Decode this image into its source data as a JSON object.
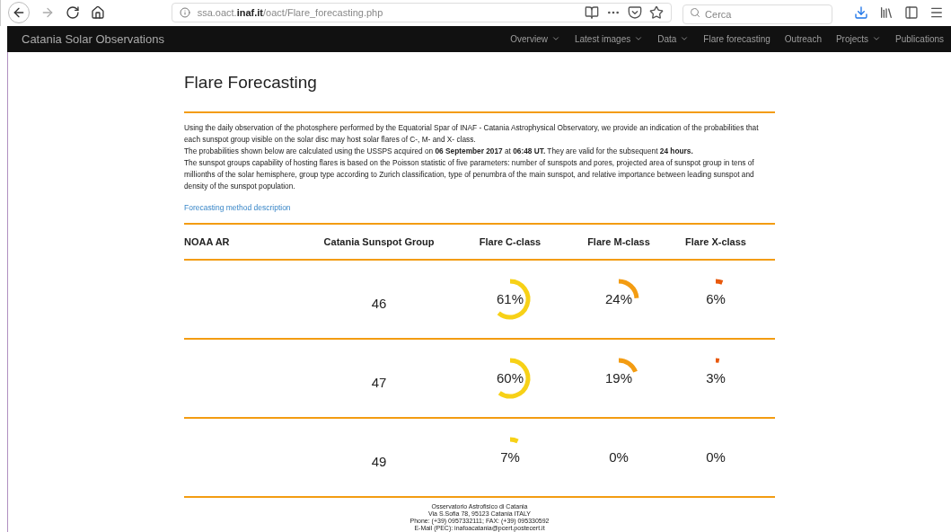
{
  "browser": {
    "url_host": "ssa.oact.",
    "url_domain": "inaf.it",
    "url_path": "/oact/Flare_forecasting.php",
    "search": {
      "placeholder": "Cerca"
    }
  },
  "navbar": {
    "brand": "Catania Solar Observations",
    "items": [
      {
        "label": "Overview",
        "dropdown": true
      },
      {
        "label": "Latest images",
        "dropdown": true
      },
      {
        "label": "Data",
        "dropdown": true
      },
      {
        "label": "Flare forecasting",
        "dropdown": false
      },
      {
        "label": "Outreach",
        "dropdown": false
      },
      {
        "label": "Projects",
        "dropdown": true
      },
      {
        "label": "Publications",
        "dropdown": false
      }
    ]
  },
  "page": {
    "title": "Flare Forecasting",
    "paragraphs": [
      "Using the daily observation of the photosphere performed by the Equatorial Spar of INAF - Catania Astrophysical Observatory, we provide an indication of the probabilities that each sunspot group visible on the solar disc may host solar flares of C-, M- and X- class.",
      "The probabilities shown below are calculated using the USSPS acquired on **06 September 2017** at **06:48 UT.** They are valid for the subsequent **24 hours.**",
      "The sunspot groups capability of hosting flares is based on the Poisson statistic of five parameters: number of sunspots and pores, projected area of sunspot group in tens of millionths of the solar hemisphere, group type according to Zurich classification, type of penumbra of the main sunspot, and relative importance between leading sunspot and density of the sunspot population."
    ],
    "link": "Forecasting method description"
  },
  "table": {
    "columns": [
      "NOAA AR",
      "Catania Sunspot Group",
      "Flare C-class",
      "Flare M-class",
      "Flare X-class"
    ],
    "rows": [
      {
        "group": "46",
        "flares": [
          {
            "reading": "61%"
          },
          {
            "reading": "24%"
          },
          {
            "reading": "6%"
          }
        ]
      },
      {
        "group": "47",
        "flares": [
          {
            "reading": "60%"
          },
          {
            "reading": "19%"
          },
          {
            "reading": "3%"
          }
        ]
      },
      {
        "group": "49",
        "flares": [
          {
            "reading": "7%"
          },
          {
            "reading": "0%"
          },
          {
            "reading": "0%"
          }
        ]
      }
    ]
  },
  "footer": {
    "lines": [
      "Osservatorio Astrofisico di Catania",
      "Via S.Sofia 78, 95123 Catania ITALY",
      "Phone: (+39) 0957332111; FAX: (+39) 095330592",
      "E-Mail (PEC): inafoacatania@pcert.postecert.it"
    ]
  }
}
